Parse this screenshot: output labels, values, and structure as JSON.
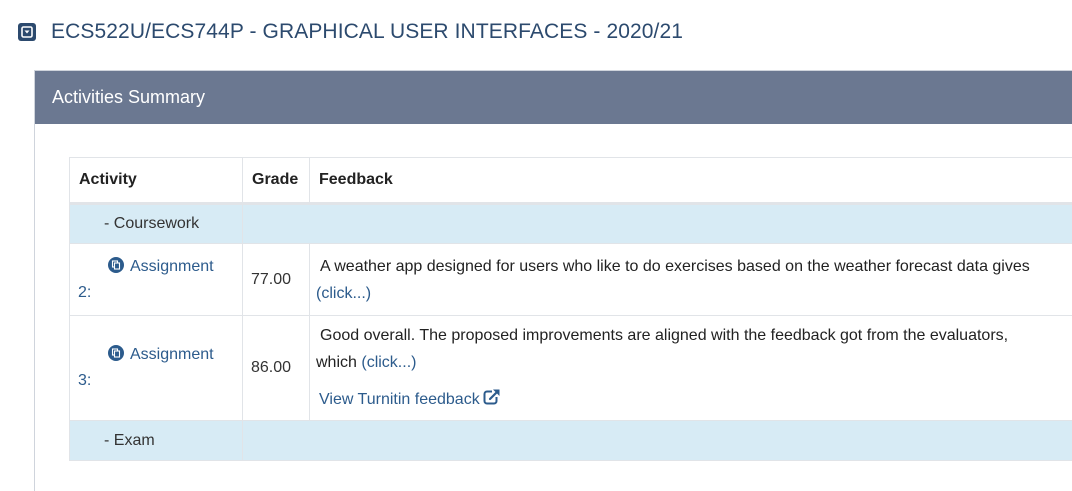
{
  "course": {
    "title": "ECS522U/ECS744P - GRAPHICAL USER INTERFACES - 2020/21"
  },
  "panel": {
    "heading": "Activities Summary"
  },
  "table": {
    "headers": {
      "activity": "Activity",
      "grade": "Grade",
      "feedback": "Feedback"
    },
    "groups": [
      {
        "label": "- Coursework"
      },
      {
        "label": "- Exam"
      }
    ],
    "rows": [
      {
        "activity_line1": "Assignment",
        "activity_line2": "2:",
        "grade": "77.00",
        "feedback_line1": "A weather app designed for users who like to do exercises based on the weather forecast data gives",
        "feedback_prefix": "",
        "feedback_more": "(click...)"
      },
      {
        "activity_line1": "Assignment",
        "activity_line2": "3:",
        "grade": "86.00",
        "feedback_line1": "Good overall. The proposed improvements are aligned with the feedback got from the evaluators,",
        "feedback_prefix": "which",
        "feedback_more": "(click...)",
        "turnitin_link": "View Turnitin feedback"
      }
    ]
  },
  "colors": {
    "brand": "#2c4a6e",
    "panel_heading_bg": "#6b7891",
    "group_row_bg": "#d7ebf5",
    "link": "#2c5b8c"
  },
  "icons": {
    "toggle": "collapse-toggle-icon",
    "assignment": "assignment-icon",
    "external": "external-link-icon"
  }
}
